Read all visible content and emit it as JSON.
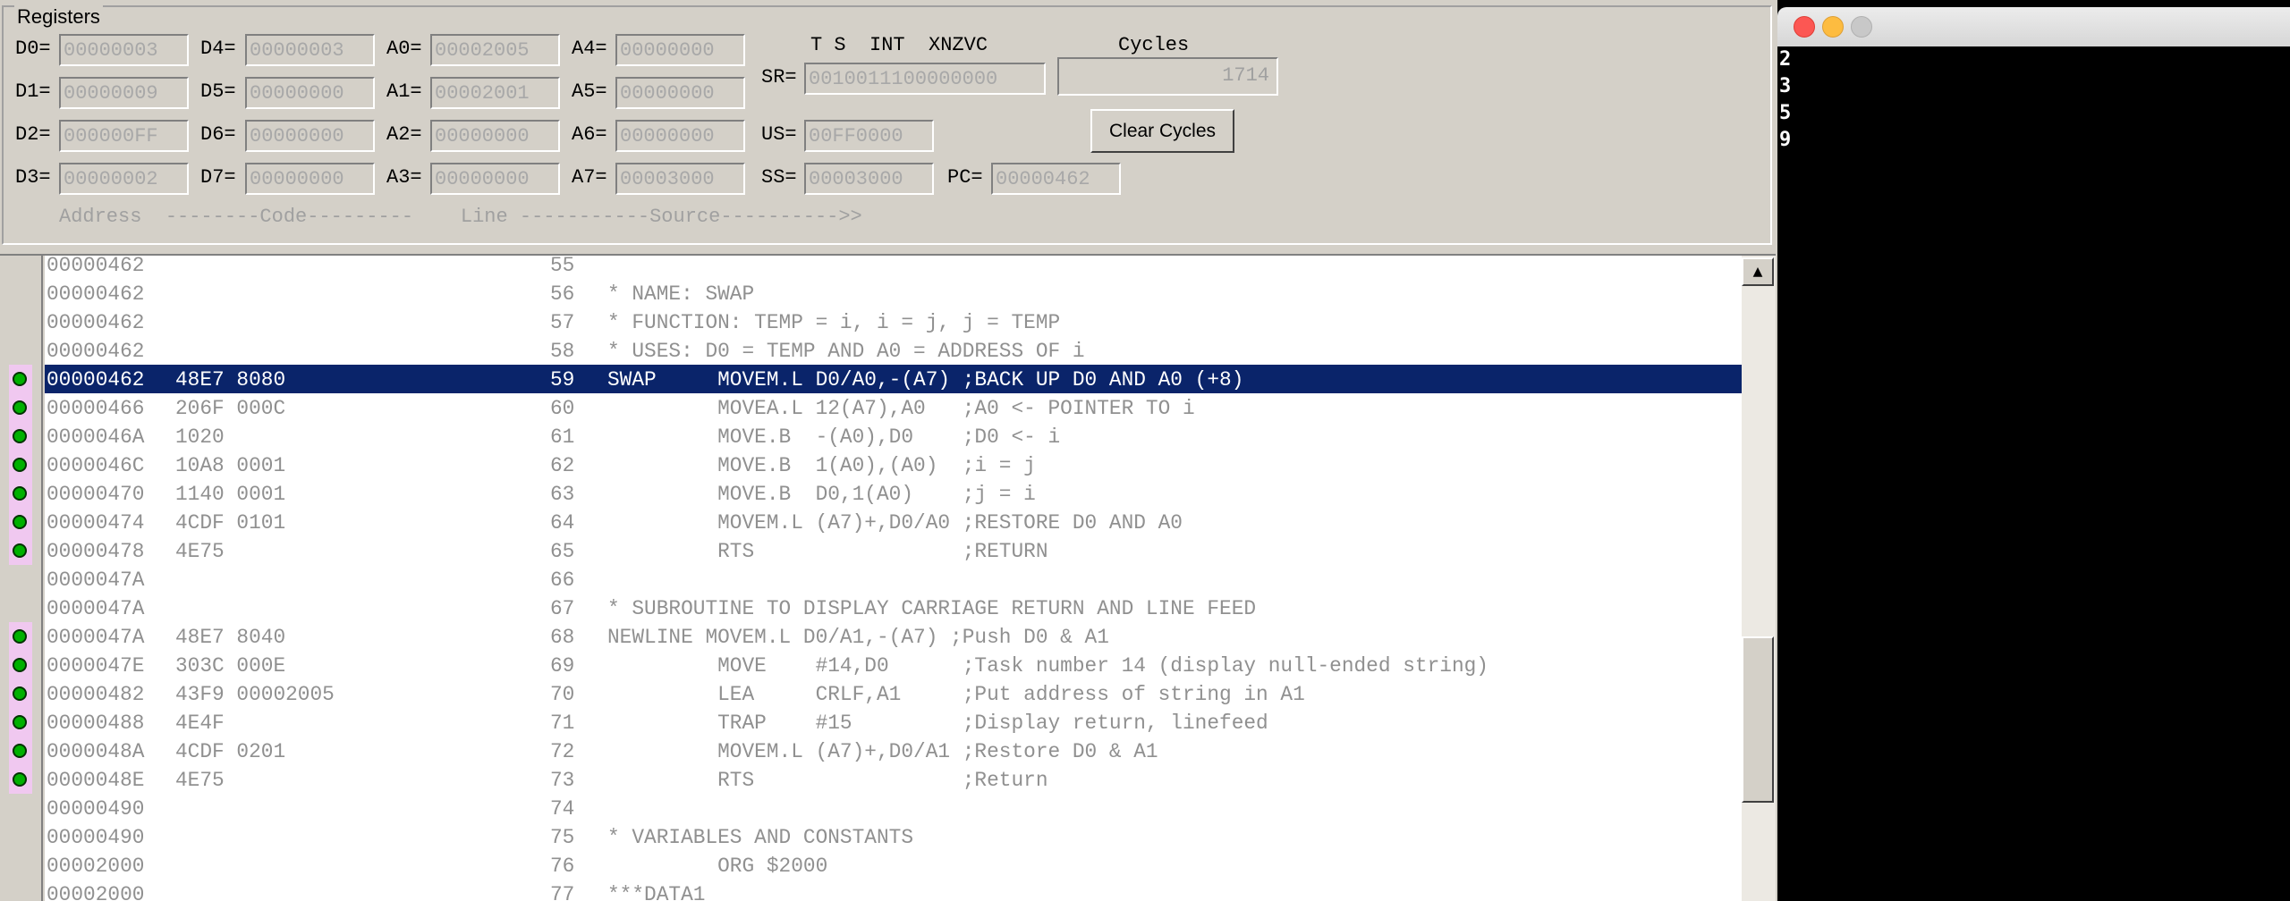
{
  "registers": {
    "group_title": "Registers",
    "d": [
      {
        "label": "D0=",
        "value": "00000003"
      },
      {
        "label": "D1=",
        "value": "00000009"
      },
      {
        "label": "D2=",
        "value": "000000FF"
      },
      {
        "label": "D3=",
        "value": "00000002"
      },
      {
        "label": "D4=",
        "value": "00000003"
      },
      {
        "label": "D5=",
        "value": "00000000"
      },
      {
        "label": "D6=",
        "value": "00000000"
      },
      {
        "label": "D7=",
        "value": "00000000"
      }
    ],
    "a": [
      {
        "label": "A0=",
        "value": "00002005"
      },
      {
        "label": "A1=",
        "value": "00002001"
      },
      {
        "label": "A2=",
        "value": "00000000"
      },
      {
        "label": "A3=",
        "value": "00000000"
      },
      {
        "label": "A4=",
        "value": "00000000"
      },
      {
        "label": "A5=",
        "value": "00000000"
      },
      {
        "label": "A6=",
        "value": "00000000"
      },
      {
        "label": "A7=",
        "value": "00003000"
      }
    ],
    "sr_header": "T S  INT  XNZVC",
    "sr": {
      "label": "SR=",
      "value": "0010011100000000"
    },
    "us": {
      "label": "US=",
      "value": "00FF0000"
    },
    "ss": {
      "label": "SS=",
      "value": "00003000"
    },
    "pc": {
      "label": "PC=",
      "value": "00000462"
    },
    "cycles_label": "Cycles",
    "cycles_value": "1714",
    "clear_cycles_label": "Clear Cycles"
  },
  "listing": {
    "column_header": "Address  --------Code---------    Line -----------Source---------->>",
    "rows": [
      {
        "addr": "00000462",
        "code": "",
        "line": "55",
        "src": ""
      },
      {
        "addr": "00000462",
        "code": "",
        "line": "56",
        "src": "* NAME: SWAP"
      },
      {
        "addr": "00000462",
        "code": "",
        "line": "57",
        "src": "* FUNCTION: TEMP = i, i = j, j = TEMP"
      },
      {
        "addr": "00000462",
        "code": "",
        "line": "58",
        "src": "* USES: D0 = TEMP AND A0 = ADDRESS OF i"
      },
      {
        "addr": "00000462",
        "code": "48E7 8080",
        "line": "59",
        "src": "SWAP     MOVEM.L D0/A0,-(A7) ;BACK UP D0 AND A0 (+8)"
      },
      {
        "addr": "00000466",
        "code": "206F 000C",
        "line": "60",
        "src": "         MOVEA.L 12(A7),A0   ;A0 <- POINTER TO i"
      },
      {
        "addr": "0000046A",
        "code": "1020",
        "line": "61",
        "src": "         MOVE.B  -(A0),D0    ;D0 <- i"
      },
      {
        "addr": "0000046C",
        "code": "10A8 0001",
        "line": "62",
        "src": "         MOVE.B  1(A0),(A0)  ;i = j"
      },
      {
        "addr": "00000470",
        "code": "1140 0001",
        "line": "63",
        "src": "         MOVE.B  D0,1(A0)    ;j = i"
      },
      {
        "addr": "00000474",
        "code": "4CDF 0101",
        "line": "64",
        "src": "         MOVEM.L (A7)+,D0/A0 ;RESTORE D0 AND A0"
      },
      {
        "addr": "00000478",
        "code": "4E75",
        "line": "65",
        "src": "         RTS                 ;RETURN"
      },
      {
        "addr": "0000047A",
        "code": "",
        "line": "66",
        "src": ""
      },
      {
        "addr": "0000047A",
        "code": "",
        "line": "67",
        "src": "* SUBROUTINE TO DISPLAY CARRIAGE RETURN AND LINE FEED"
      },
      {
        "addr": "0000047A",
        "code": "48E7 8040",
        "line": "68",
        "src": "NEWLINE MOVEM.L D0/A1,-(A7) ;Push D0 & A1"
      },
      {
        "addr": "0000047E",
        "code": "303C 000E",
        "line": "69",
        "src": "         MOVE    #14,D0      ;Task number 14 (display null-ended string)"
      },
      {
        "addr": "00000482",
        "code": "43F9 00002005",
        "line": "70",
        "src": "         LEA     CRLF,A1     ;Put address of string in A1"
      },
      {
        "addr": "00000488",
        "code": "4E4F",
        "line": "71",
        "src": "         TRAP    #15         ;Display return, linefeed"
      },
      {
        "addr": "0000048A",
        "code": "4CDF 0201",
        "line": "72",
        "src": "         MOVEM.L (A7)+,D0/A1 ;Restore D0 & A1"
      },
      {
        "addr": "0000048E",
        "code": "4E75",
        "line": "73",
        "src": "         RTS                 ;Return"
      },
      {
        "addr": "00000490",
        "code": "",
        "line": "74",
        "src": ""
      },
      {
        "addr": "00000490",
        "code": "",
        "line": "75",
        "src": "* VARIABLES AND CONSTANTS"
      },
      {
        "addr": "00002000",
        "code": "",
        "line": "76",
        "src": "         ORG $2000"
      },
      {
        "addr": "00002000",
        "code": "",
        "line": "77",
        "src": "***DATA1"
      }
    ],
    "selected_line": "59",
    "breakpoint_lines": [
      "59",
      "60",
      "61",
      "62",
      "63",
      "64",
      "65",
      "68",
      "69",
      "70",
      "71",
      "72",
      "73"
    ]
  },
  "terminal": {
    "output_lines": [
      "2",
      "3",
      "5",
      "9"
    ]
  },
  "colors": {
    "selection": "#0a246a",
    "breakpoint": "#00b000",
    "window_bg": "#d4d0c8"
  }
}
